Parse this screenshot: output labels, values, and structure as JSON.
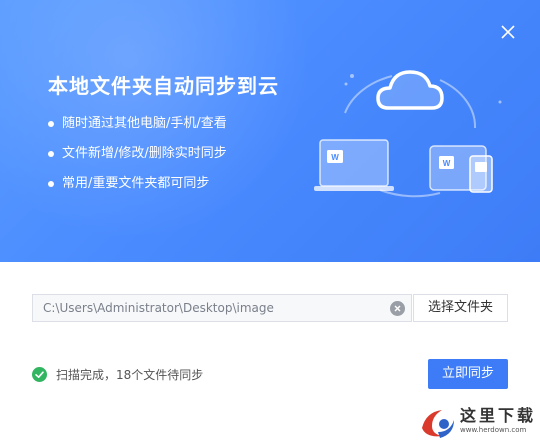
{
  "hero": {
    "title": "本地文件夹自动同步到云",
    "features": [
      "随时通过其他电脑/手机/查看",
      "文件新增/修改/删除实时同步",
      "常用/重要文件夹都可同步"
    ]
  },
  "folder": {
    "path": "C:\\Users\\Administrator\\Desktop\\image",
    "choose_label": "选择文件夹"
  },
  "status": {
    "text": "扫描完成，18个文件待同步"
  },
  "actions": {
    "sync_label": "立即同步"
  },
  "watermark": {
    "text": "这里下载",
    "url": "www.herdown.com"
  },
  "icons": {
    "close": "close-icon",
    "cloud": "cloud-icon",
    "laptop": "laptop-icon",
    "tablet": "tablet-icon",
    "phone": "phone-icon",
    "clear": "clear-icon",
    "success": "check-circle-icon"
  },
  "colors": {
    "accent": "#3d7cf6",
    "hero_start": "#5a9cff",
    "success": "#32b560"
  }
}
